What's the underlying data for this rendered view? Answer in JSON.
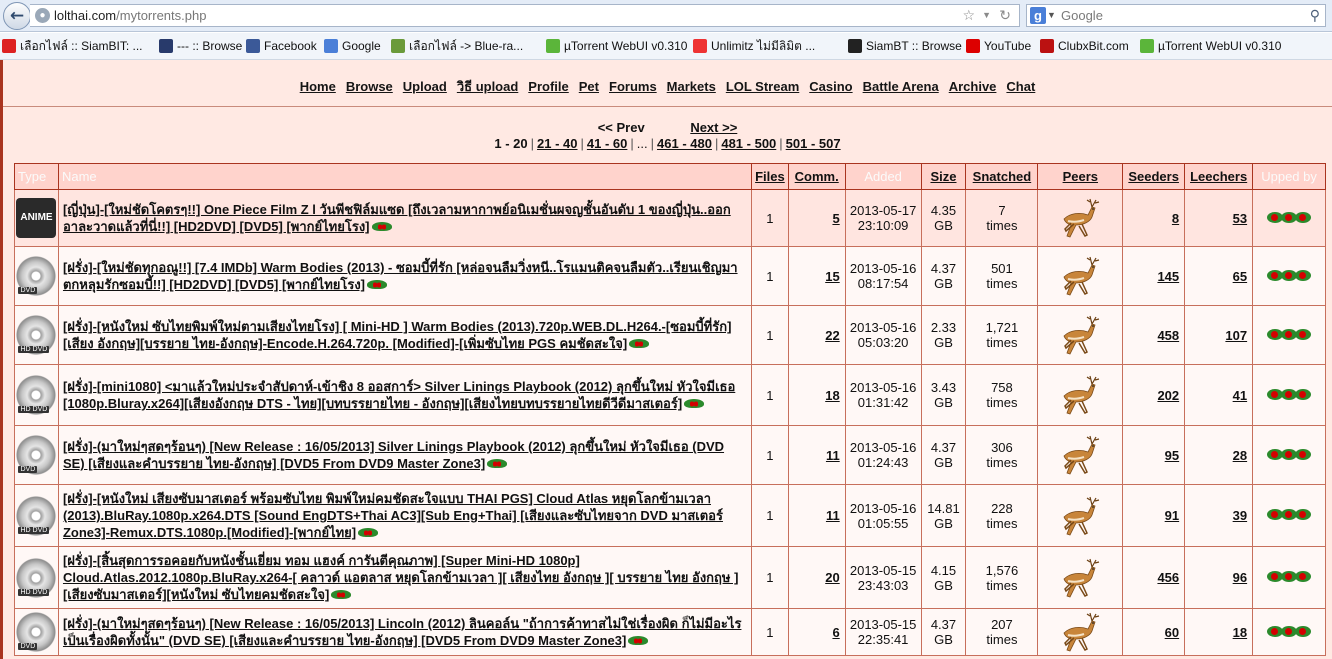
{
  "browser": {
    "url_host": "lolthai.com",
    "url_path": "/mytorrents.php",
    "search_placeholder": "Google",
    "bookmarks": [
      {
        "label": "เลือกไฟล์ :: SiamBIT: ...",
        "icon": "thai-flag-icon",
        "color": "#d22"
      },
      {
        "label": "--- :: Browse",
        "icon": "lol-icon",
        "color": "#283a6b"
      },
      {
        "label": "Facebook",
        "icon": "facebook-icon",
        "color": "#3b5998"
      },
      {
        "label": "Google",
        "icon": "google-icon",
        "color": "#4a7fd8"
      },
      {
        "label": "เลือกไฟล์ -> Blue-ra...",
        "icon": "blue-ra-icon",
        "color": "#6a9a3a"
      },
      {
        "label": "µTorrent WebUI v0.310",
        "icon": "utorrent-icon",
        "color": "#5bb53a"
      },
      {
        "label": "Unlimitz ไม่มีลิมิต ...",
        "icon": "unlimitz-icon",
        "color": "#e33"
      },
      {
        "label": "SiamBT :: Browse",
        "icon": "siambt-icon",
        "color": "#222"
      },
      {
        "label": "YouTube",
        "icon": "youtube-icon",
        "color": "#d00"
      },
      {
        "label": "ClubxBit.com",
        "icon": "clubxbit-icon",
        "color": "#b11"
      },
      {
        "label": "µTorrent WebUI v0.310",
        "icon": "utorrent-icon",
        "color": "#5bb53a"
      }
    ]
  },
  "nav": [
    "Home",
    "Browse",
    "Upload",
    "วิธี upload",
    "Profile",
    "Pet",
    "Forums",
    "Markets",
    "LOL Stream",
    "Casino",
    "Battle Arena",
    "Archive",
    "Chat"
  ],
  "pager": {
    "prev": "<< Prev",
    "next": "Next >>",
    "current": "1 - 20",
    "pages": [
      "21 - 40",
      "41 - 60",
      "...",
      "461 - 480",
      "481 - 500",
      "501 - 507"
    ]
  },
  "table": {
    "headers": {
      "type": "Type",
      "name": "Name",
      "files": "Files",
      "comments": "Comm.",
      "added": "Added",
      "size": "Size",
      "snatched": "Snatched",
      "peers": "Peers",
      "seeders": "Seeders",
      "leechers": "Leechers",
      "upped_by": "Upped by"
    },
    "rows": [
      {
        "type": "anime",
        "type_label": "ANIME",
        "name": "[ญี่ปุ่น]-[ใหม่ชัดโคตรๆ!!] One Piece Film Z l วันพีชฟิล์มแซด [ถึงเวลามหากาพย์อนิเมชั่นผจญชั้นอันดับ 1 ของญี่ปุ่น..ออกอาละวาดแล้วที่นี่!!] [HD2DVD] [DVD5] [พากย์ไทยโรง]",
        "files": "1",
        "comments": "5",
        "added_date": "2013-05-17",
        "added_time": "23:10:09",
        "size_num": "4.35",
        "size_unit": "GB",
        "snatched_num": "7",
        "snatched_unit": "times",
        "seeders": "8",
        "leechers": "53"
      },
      {
        "type": "dvd",
        "type_label": "DVD",
        "name": "[ฝรั่ง]-[ใหม่ชัดทุกอณู!!] [7.4 IMDb] Warm Bodies (2013) - ซอมบี้ที่รัก [หล่อจนลืมวิ่งหนี..โรแมนติคจนลืมตัว..เรียนเชิญมาตกหลุมรักซอมบี้!!] [HD2DVD] [DVD5] [พากย์ไทยโรง]",
        "files": "1",
        "comments": "15",
        "added_date": "2013-05-16",
        "added_time": "08:17:54",
        "size_num": "4.37",
        "size_unit": "GB",
        "snatched_num": "501",
        "snatched_unit": "times",
        "seeders": "145",
        "leechers": "65"
      },
      {
        "type": "hddvd",
        "type_label": "HD DVD",
        "name": "[ฝรั่ง]-[หนังใหม่ ซับไทยพิมพ์ใหม่ตามเสียงไทยโรง] [ Mini-HD ] Warm Bodies (2013).720p.WEB.DL.H264.-[ซอมบี้ที่รัก] [เสียง อังกฤษ][บรรยาย ไทย-อังกฤษ]-Encode.H.264.720p. [Modified]-[เพิ่มซับไทย PGS คมชัดสะใจ]",
        "files": "1",
        "comments": "22",
        "added_date": "2013-05-16",
        "added_time": "05:03:20",
        "size_num": "2.33",
        "size_unit": "GB",
        "snatched_num": "1,721",
        "snatched_unit": "times",
        "seeders": "458",
        "leechers": "107"
      },
      {
        "type": "hddvd",
        "type_label": "HD DVD",
        "name": "[ฝรั่ง]-[mini1080] <มาแล้วใหม่ประจำสัปดาห์-เข้าชิง 8 ออสการ์> Silver Linings Playbook (2012) ลุกขึ้นใหม่ หัวใจมีเธอ [1080p.Bluray.x264][เสียงอังกฤษ DTS - ไทย][บทบรรยายไทย - อังกฤษ][เสียงไทยบทบรรยายไทยดีวีดีมาสเตอร์]",
        "files": "1",
        "comments": "18",
        "added_date": "2013-05-16",
        "added_time": "01:31:42",
        "size_num": "3.43",
        "size_unit": "GB",
        "snatched_num": "758",
        "snatched_unit": "times",
        "seeders": "202",
        "leechers": "41"
      },
      {
        "type": "dvd",
        "type_label": "DVD",
        "name": "[ฝรั่ง]-(มาใหม่ๆสดๆร้อนๆ) [New Release : 16/05/2013] Silver Linings Playbook (2012) ลุกขึ้นใหม่ หัวใจมีเธอ (DVD SE) [เสียงและคำบรรยาย ไทย-อังกฤษ] [DVD5 From DVD9 Master Zone3]",
        "files": "1",
        "comments": "11",
        "added_date": "2013-05-16",
        "added_time": "01:24:43",
        "size_num": "4.37",
        "size_unit": "GB",
        "snatched_num": "306",
        "snatched_unit": "times",
        "seeders": "95",
        "leechers": "28"
      },
      {
        "type": "hddvd",
        "type_label": "HD DVD",
        "name": "[ฝรั่ง]-[หนังใหม่ เสียงซับมาสเตอร์ พร้อมซับไทย พิมพ์ใหม่คมชัดสะใจแบบ THAI PGS] Cloud Atlas หยุดโลกข้ามเวลา (2013).BluRay.1080p.x264.DTS [Sound EngDTS+Thai AC3][Sub Eng+Thai] [เสียงและซับไทยจาก DVD มาสเตอร์ Zone3]-Remux.DTS.1080p.[Modified]-[พากย์ไทย]",
        "files": "1",
        "comments": "11",
        "added_date": "2013-05-16",
        "added_time": "01:05:55",
        "size_num": "14.81",
        "size_unit": "GB",
        "snatched_num": "228",
        "snatched_unit": "times",
        "seeders": "91",
        "leechers": "39"
      },
      {
        "type": "hddvd",
        "type_label": "HD DVD",
        "name": "[ฝรั่ง]-[สิ้นสุดการรอคอยกับหนังชั้นเยี่ยม ทอม แฮงค์ การันตีคุณภาพ] [Super Mini-HD 1080p] Cloud.Atlas.2012.1080p.BluRay.x264-[ คลาวด์ แอตลาส หยุดโลกข้ามเวลา ][ เสียงไทย อังกฤษ ][ บรรยาย ไทย อังกฤษ ][เสียงซับมาสเตอร์][หนังใหม่ ซับไทยคมชัดสะใจ]",
        "files": "1",
        "comments": "20",
        "added_date": "2013-05-15",
        "added_time": "23:43:03",
        "size_num": "4.15",
        "size_unit": "GB",
        "snatched_num": "1,576",
        "snatched_unit": "times",
        "seeders": "456",
        "leechers": "96"
      },
      {
        "type": "dvd",
        "type_label": "DVD",
        "name": "[ฝรั่ง]-(มาใหม่ๆสดๆร้อนๆ) [New Release : 16/05/2013] Lincoln (2012) ลินคอล์น \"ถ้าการค้าทาสไม่ใช่เรื่องผิด ก็ไม่มีอะไรเป็นเรื่องผิดทั้งนั้น\" (DVD SE) [เสียงและคำบรรยาย ไทย-อังกฤษ] [DVD5 From DVD9 Master Zone3]",
        "files": "1",
        "comments": "6",
        "added_date": "2013-05-15",
        "added_time": "22:35:41",
        "size_num": "4.37",
        "size_unit": "GB",
        "snatched_num": "207",
        "snatched_unit": "times",
        "seeders": "60",
        "leechers": "18"
      }
    ]
  }
}
